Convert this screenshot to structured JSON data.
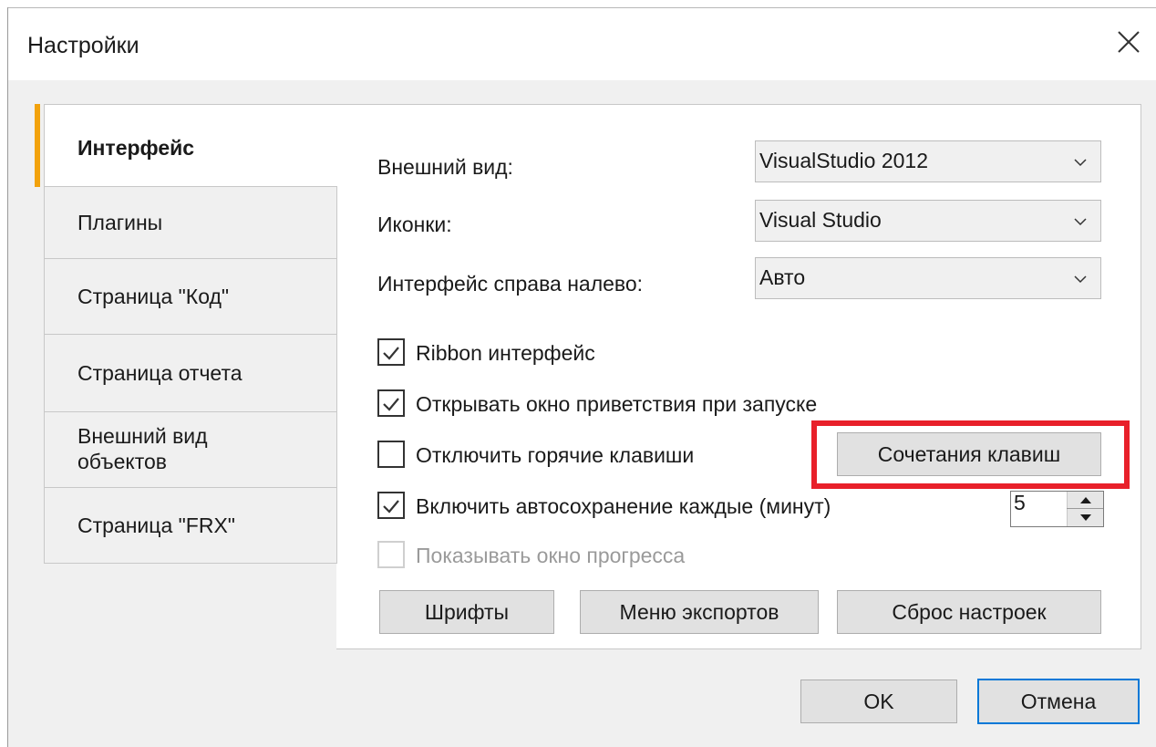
{
  "window": {
    "title": "Настройки"
  },
  "tabs": [
    {
      "label": "Интерфейс"
    },
    {
      "label": "Плагины"
    },
    {
      "label": "Страница \"Код\""
    },
    {
      "label": "Страница отчета"
    },
    {
      "label": "Внешний вид объектов"
    },
    {
      "label": "Страница \"FRX\""
    }
  ],
  "settings": {
    "appearance_label": "Внешний вид:",
    "appearance_value": "VisualStudio 2012",
    "icons_label": "Иконки:",
    "icons_value": "Visual Studio",
    "rtl_label": "Интерфейс справа налево:",
    "rtl_value": "Авто"
  },
  "checkboxes": [
    {
      "label": "Ribbon интерфейс",
      "checked": true
    },
    {
      "label": "Открывать окно приветствия при запуске",
      "checked": true
    },
    {
      "label": "Отключить горячие клавиши",
      "checked": false
    },
    {
      "label": "Включить автосохранение каждые (минут)",
      "checked": true
    },
    {
      "label": "Показывать окно прогресса",
      "checked": false,
      "disabled": true
    }
  ],
  "autosave_minutes": "5",
  "buttons": {
    "shortcuts": "Сочетания клавиш",
    "fonts": "Шрифты",
    "export_menu": "Меню экспортов",
    "reset": "Сброс настроек",
    "ok": "OK",
    "cancel": "Отмена"
  },
  "colors": {
    "accent_tab": "#f2a20c",
    "highlight": "#e8202a",
    "primary_border": "#0078d7"
  }
}
